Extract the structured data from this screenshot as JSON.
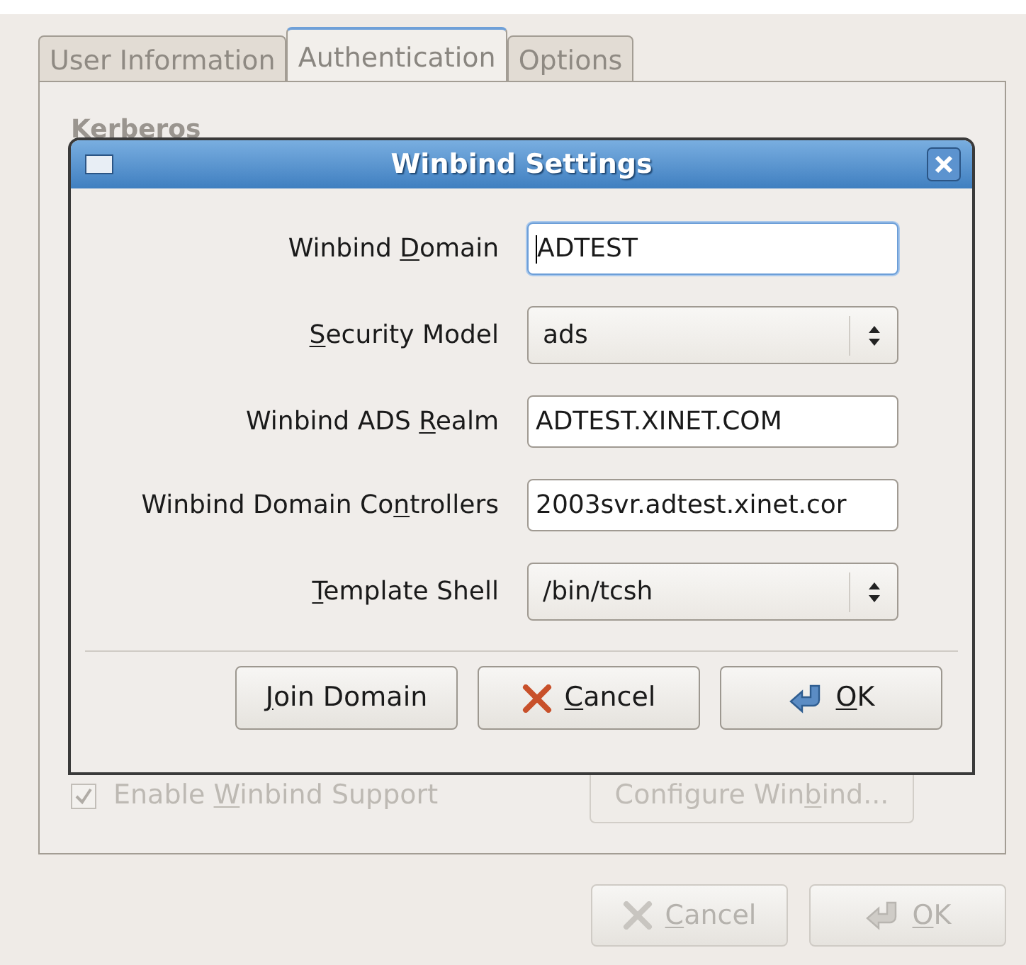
{
  "window": {
    "tabs": [
      {
        "label": "User Information",
        "selected": false
      },
      {
        "label": "Authentication",
        "selected": true
      },
      {
        "label": "Options",
        "selected": false
      }
    ],
    "section_heading": "Kerberos",
    "winbind_checkbox": {
      "label": {
        "pre": "Enable ",
        "key": "W",
        "post": "inbind Support"
      },
      "checked": true,
      "disabled": true
    },
    "configure_button": {
      "label": {
        "pre": "Configure Win",
        "key": "b",
        "post": "ind..."
      },
      "disabled": true
    },
    "buttons": [
      {
        "kind": "cancel",
        "label": {
          "key": "C",
          "post": "ancel"
        },
        "disabled": true
      },
      {
        "kind": "ok",
        "label": {
          "key": "O",
          "post": "K"
        },
        "disabled": true
      }
    ]
  },
  "dialog": {
    "title": "Winbind Settings",
    "fields": [
      {
        "kind": "text",
        "label": {
          "pre": "Winbind ",
          "key": "D",
          "post": "omain"
        },
        "value": "ADTEST",
        "focused": true
      },
      {
        "kind": "select",
        "label": {
          "key": "S",
          "post": "ecurity Model"
        },
        "value": "ads",
        "focused": false
      },
      {
        "kind": "text",
        "label": {
          "pre": "Winbind ADS ",
          "key": "R",
          "post": "ealm"
        },
        "value": "ADTEST.XINET.COM",
        "focused": false
      },
      {
        "kind": "text",
        "label": {
          "pre": "Winbind Domain Co",
          "key": "n",
          "post": "trollers"
        },
        "value": "2003svr.adtest.xinet.cor",
        "focused": false
      },
      {
        "kind": "select",
        "label": {
          "key": "T",
          "post": "emplate Shell"
        },
        "value": "/bin/tcsh",
        "focused": false
      }
    ],
    "buttons": [
      {
        "kind": "join",
        "label": {
          "key": "J",
          "post": "oin Domain"
        },
        "disabled": false
      },
      {
        "kind": "cancel",
        "label": {
          "key": "C",
          "post": "ancel"
        },
        "disabled": false
      },
      {
        "kind": "ok",
        "label": {
          "key": "O",
          "post": "K"
        },
        "disabled": false
      }
    ]
  }
}
